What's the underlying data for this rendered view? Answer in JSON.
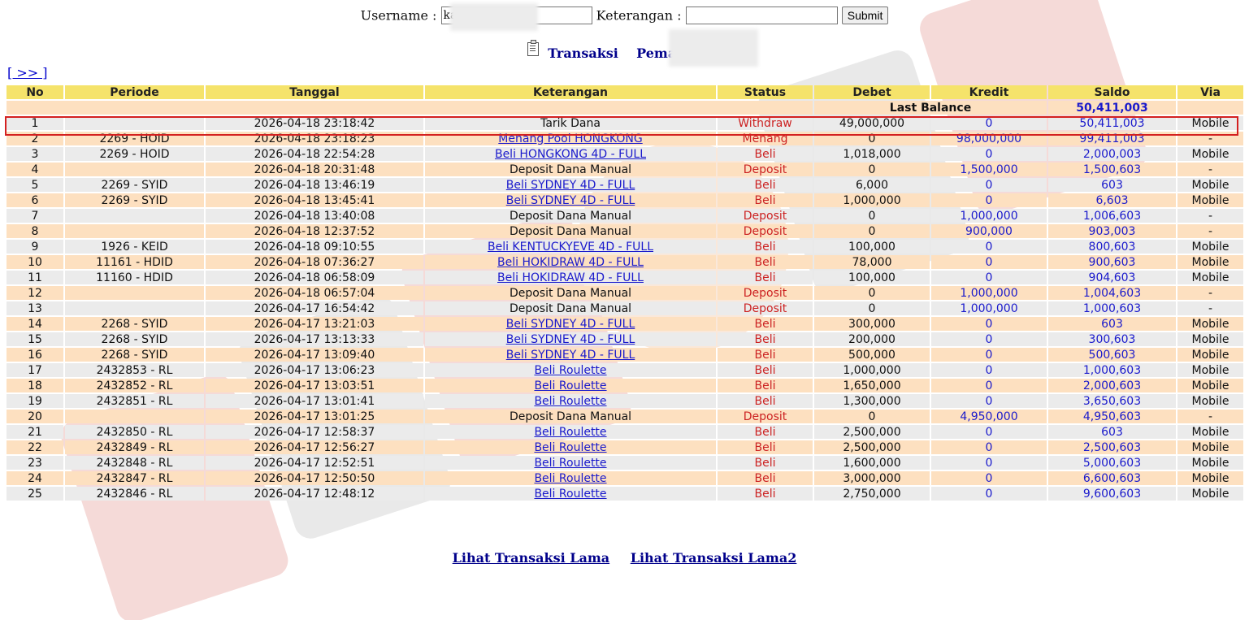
{
  "search_form": {
    "username_label": "Username :",
    "username_value": "ka",
    "keterangan_label": "Keterangan :",
    "keterangan_value": "",
    "submit_label": "Submit"
  },
  "title": {
    "transaksi": "Transaksi",
    "pemain_label": "Pemain : ka"
  },
  "next_link": "[ >> ]",
  "table": {
    "headers": [
      "No",
      "Periode",
      "Tanggal",
      "Keterangan",
      "Status",
      "Debet",
      "Kredit",
      "Saldo",
      "Via"
    ],
    "last_balance_label": "Last Balance",
    "last_balance_value": "50,411,003",
    "rows": [
      {
        "no": "1",
        "periode": "",
        "tanggal": "2026-04-18 23:18:42",
        "keterangan": "Tarik Dana",
        "link": false,
        "status": "Withdraw",
        "debet": "49,000,000",
        "kredit": "0",
        "saldo": "50,411,003",
        "via": "Mobile"
      },
      {
        "no": "2",
        "periode": "2269 - HOID",
        "tanggal": "2026-04-18 23:18:23",
        "keterangan": "Menang Pool HONGKONG",
        "link": true,
        "status": "Menang",
        "debet": "0",
        "kredit": "98,000,000",
        "saldo": "99,411,003",
        "via": "-"
      },
      {
        "no": "3",
        "periode": "2269 - HOID",
        "tanggal": "2026-04-18 22:54:28",
        "keterangan": "Beli HONGKONG 4D - FULL",
        "link": true,
        "status": "Beli",
        "debet": "1,018,000",
        "kredit": "0",
        "saldo": "2,000,003",
        "via": "Mobile"
      },
      {
        "no": "4",
        "periode": "",
        "tanggal": "2026-04-18 20:31:48",
        "keterangan": "Deposit Dana Manual",
        "link": false,
        "status": "Deposit",
        "debet": "0",
        "kredit": "1,500,000",
        "saldo": "1,500,603",
        "via": "-"
      },
      {
        "no": "5",
        "periode": "2269 - SYID",
        "tanggal": "2026-04-18 13:46:19",
        "keterangan": "Beli SYDNEY 4D - FULL",
        "link": true,
        "status": "Beli",
        "debet": "6,000",
        "kredit": "0",
        "saldo": "603",
        "via": "Mobile"
      },
      {
        "no": "6",
        "periode": "2269 - SYID",
        "tanggal": "2026-04-18 13:45:41",
        "keterangan": "Beli SYDNEY 4D - FULL",
        "link": true,
        "status": "Beli",
        "debet": "1,000,000",
        "kredit": "0",
        "saldo": "6,603",
        "via": "Mobile"
      },
      {
        "no": "7",
        "periode": "",
        "tanggal": "2026-04-18 13:40:08",
        "keterangan": "Deposit Dana Manual",
        "link": false,
        "status": "Deposit",
        "debet": "0",
        "kredit": "1,000,000",
        "saldo": "1,006,603",
        "via": "-"
      },
      {
        "no": "8",
        "periode": "",
        "tanggal": "2026-04-18 12:37:52",
        "keterangan": "Deposit Dana Manual",
        "link": false,
        "status": "Deposit",
        "debet": "0",
        "kredit": "900,000",
        "saldo": "903,003",
        "via": "-"
      },
      {
        "no": "9",
        "periode": "1926 - KEID",
        "tanggal": "2026-04-18 09:10:55",
        "keterangan": "Beli KENTUCKYEVE 4D - FULL",
        "link": true,
        "status": "Beli",
        "debet": "100,000",
        "kredit": "0",
        "saldo": "800,603",
        "via": "Mobile"
      },
      {
        "no": "10",
        "periode": "11161 - HDID",
        "tanggal": "2026-04-18 07:36:27",
        "keterangan": "Beli HOKIDRAW 4D - FULL",
        "link": true,
        "status": "Beli",
        "debet": "78,000",
        "kredit": "0",
        "saldo": "900,603",
        "via": "Mobile"
      },
      {
        "no": "11",
        "periode": "11160 - HDID",
        "tanggal": "2026-04-18 06:58:09",
        "keterangan": "Beli HOKIDRAW 4D - FULL",
        "link": true,
        "status": "Beli",
        "debet": "100,000",
        "kredit": "0",
        "saldo": "904,603",
        "via": "Mobile"
      },
      {
        "no": "12",
        "periode": "",
        "tanggal": "2026-04-18 06:57:04",
        "keterangan": "Deposit Dana Manual",
        "link": false,
        "status": "Deposit",
        "debet": "0",
        "kredit": "1,000,000",
        "saldo": "1,004,603",
        "via": "-"
      },
      {
        "no": "13",
        "periode": "",
        "tanggal": "2026-04-17 16:54:42",
        "keterangan": "Deposit Dana Manual",
        "link": false,
        "status": "Deposit",
        "debet": "0",
        "kredit": "1,000,000",
        "saldo": "1,000,603",
        "via": "-"
      },
      {
        "no": "14",
        "periode": "2268 - SYID",
        "tanggal": "2026-04-17 13:21:03",
        "keterangan": "Beli SYDNEY 4D - FULL",
        "link": true,
        "status": "Beli",
        "debet": "300,000",
        "kredit": "0",
        "saldo": "603",
        "via": "Mobile"
      },
      {
        "no": "15",
        "periode": "2268 - SYID",
        "tanggal": "2026-04-17 13:13:33",
        "keterangan": "Beli SYDNEY 4D - FULL",
        "link": true,
        "status": "Beli",
        "debet": "200,000",
        "kredit": "0",
        "saldo": "300,603",
        "via": "Mobile"
      },
      {
        "no": "16",
        "periode": "2268 - SYID",
        "tanggal": "2026-04-17 13:09:40",
        "keterangan": "Beli SYDNEY 4D - FULL",
        "link": true,
        "status": "Beli",
        "debet": "500,000",
        "kredit": "0",
        "saldo": "500,603",
        "via": "Mobile"
      },
      {
        "no": "17",
        "periode": "2432853 - RL",
        "tanggal": "2026-04-17 13:06:23",
        "keterangan": "Beli Roulette",
        "link": true,
        "status": "Beli",
        "debet": "1,000,000",
        "kredit": "0",
        "saldo": "1,000,603",
        "via": "Mobile"
      },
      {
        "no": "18",
        "periode": "2432852 - RL",
        "tanggal": "2026-04-17 13:03:51",
        "keterangan": "Beli Roulette",
        "link": true,
        "status": "Beli",
        "debet": "1,650,000",
        "kredit": "0",
        "saldo": "2,000,603",
        "via": "Mobile"
      },
      {
        "no": "19",
        "periode": "2432851 - RL",
        "tanggal": "2026-04-17 13:01:41",
        "keterangan": "Beli Roulette",
        "link": true,
        "status": "Beli",
        "debet": "1,300,000",
        "kredit": "0",
        "saldo": "3,650,603",
        "via": "Mobile"
      },
      {
        "no": "20",
        "periode": "",
        "tanggal": "2026-04-17 13:01:25",
        "keterangan": "Deposit Dana Manual",
        "link": false,
        "status": "Deposit",
        "debet": "0",
        "kredit": "4,950,000",
        "saldo": "4,950,603",
        "via": "-"
      },
      {
        "no": "21",
        "periode": "2432850 - RL",
        "tanggal": "2026-04-17 12:58:37",
        "keterangan": "Beli Roulette",
        "link": true,
        "status": "Beli",
        "debet": "2,500,000",
        "kredit": "0",
        "saldo": "603",
        "via": "Mobile"
      },
      {
        "no": "22",
        "periode": "2432849 - RL",
        "tanggal": "2026-04-17 12:56:27",
        "keterangan": "Beli Roulette",
        "link": true,
        "status": "Beli",
        "debet": "2,500,000",
        "kredit": "0",
        "saldo": "2,500,603",
        "via": "Mobile"
      },
      {
        "no": "23",
        "periode": "2432848 - RL",
        "tanggal": "2026-04-17 12:52:51",
        "keterangan": "Beli Roulette",
        "link": true,
        "status": "Beli",
        "debet": "1,600,000",
        "kredit": "0",
        "saldo": "5,000,603",
        "via": "Mobile"
      },
      {
        "no": "24",
        "periode": "2432847 - RL",
        "tanggal": "2026-04-17 12:50:50",
        "keterangan": "Beli Roulette",
        "link": true,
        "status": "Beli",
        "debet": "3,000,000",
        "kredit": "0",
        "saldo": "6,600,603",
        "via": "Mobile"
      },
      {
        "no": "25",
        "periode": "2432846 - RL",
        "tanggal": "2026-04-17 12:48:12",
        "keterangan": "Beli Roulette",
        "link": true,
        "status": "Beli",
        "debet": "2,750,000",
        "kredit": "0",
        "saldo": "9,600,603",
        "via": "Mobile"
      }
    ]
  },
  "footer": {
    "link1": "Lihat Transaksi Lama",
    "link2": "Lihat Transaksi Lama2"
  },
  "colors": {
    "header_bg": "#f5e36b",
    "row_odd": "#ebebeb",
    "row_even": "#fde0c0",
    "status_red": "#cc2222",
    "value_blue": "#1a1acc",
    "highlight_border": "#d42020"
  }
}
